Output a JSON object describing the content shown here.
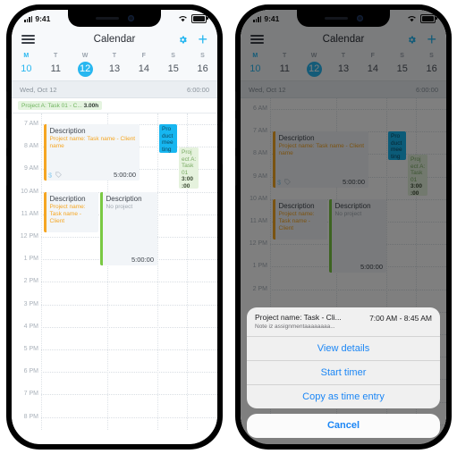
{
  "status_bar": {
    "time": "9:41",
    "signal_icon": "cellular-bars-icon",
    "wifi_icon": "wifi-icon",
    "battery_icon": "battery-icon"
  },
  "nav": {
    "menu_icon": "hamburger-menu-icon",
    "title": "Calendar",
    "settings_icon": "gear-icon",
    "add_icon": "plus-icon",
    "add_label": "+"
  },
  "week": {
    "days": [
      {
        "dow": "M",
        "num": "10",
        "dow_selected": true,
        "num_accent": true,
        "today": false
      },
      {
        "dow": "T",
        "num": "11",
        "dow_selected": false,
        "num_accent": false,
        "today": false
      },
      {
        "dow": "W",
        "num": "12",
        "dow_selected": false,
        "num_accent": false,
        "today": true
      },
      {
        "dow": "T",
        "num": "13",
        "dow_selected": false,
        "num_accent": false,
        "today": false
      },
      {
        "dow": "F",
        "num": "14",
        "dow_selected": false,
        "num_accent": false,
        "today": false
      },
      {
        "dow": "S",
        "num": "15",
        "dow_selected": false,
        "num_accent": false,
        "today": false
      },
      {
        "dow": "S",
        "num": "16",
        "dow_selected": false,
        "num_accent": false,
        "today": false
      }
    ]
  },
  "day_header": {
    "date": "Wed, Oct 12",
    "total": "6:00:00"
  },
  "all_day": {
    "label": "Project A: Task 01 - C...",
    "duration": "3.00h"
  },
  "grid_left": {
    "hours": [
      "7 AM",
      "8 AM",
      "9 AM",
      "10 AM",
      "11 AM",
      "12 PM",
      "1 PM",
      "2 PM",
      "3 PM",
      "4 PM",
      "5 PM",
      "6 PM",
      "7 PM",
      "8 PM"
    ]
  },
  "grid_right": {
    "hours": [
      "6 AM",
      "7 AM",
      "8 AM",
      "9 AM",
      "10 AM",
      "11 AM",
      "12 PM",
      "1 PM",
      "2 PM",
      "3 PM",
      "4 PM",
      "5 PM",
      "6 PM",
      "7 PM",
      "8 PM"
    ]
  },
  "events": {
    "morning": {
      "title": "Description",
      "subtitle": "Project name: Task name - Client name",
      "duration": "5:00:00",
      "billable_icon": "dollar-icon",
      "tag_icon": "tag-icon",
      "color": "#f5a623"
    },
    "noon_orange": {
      "title": "Description",
      "subtitle": "Project name: Task name - Client",
      "color": "#f5a623"
    },
    "noon_green": {
      "title": "Description",
      "subtitle": "No project",
      "duration": "5:00:00",
      "color": "#7ac943"
    },
    "product_meeting": {
      "title": "Pro duct mee ting",
      "color": "#17b6f0"
    },
    "project_a": {
      "title": "Proj ect A: Task 01",
      "duration": "3:00 :00",
      "color": "#e5f2dd"
    }
  },
  "action_sheet": {
    "header": {
      "title": "Project name: Task - Cli...",
      "note": "Note iz assignmentaaaaaaaa...",
      "time": "7:00 AM - 8:45 AM"
    },
    "items": [
      "View details",
      "Start timer",
      "Copy as time entry"
    ],
    "cancel": "Cancel"
  },
  "colors": {
    "accent": "#28b7f0",
    "link": "#1b86f5",
    "orange": "#f5a623",
    "green": "#7ac943"
  }
}
